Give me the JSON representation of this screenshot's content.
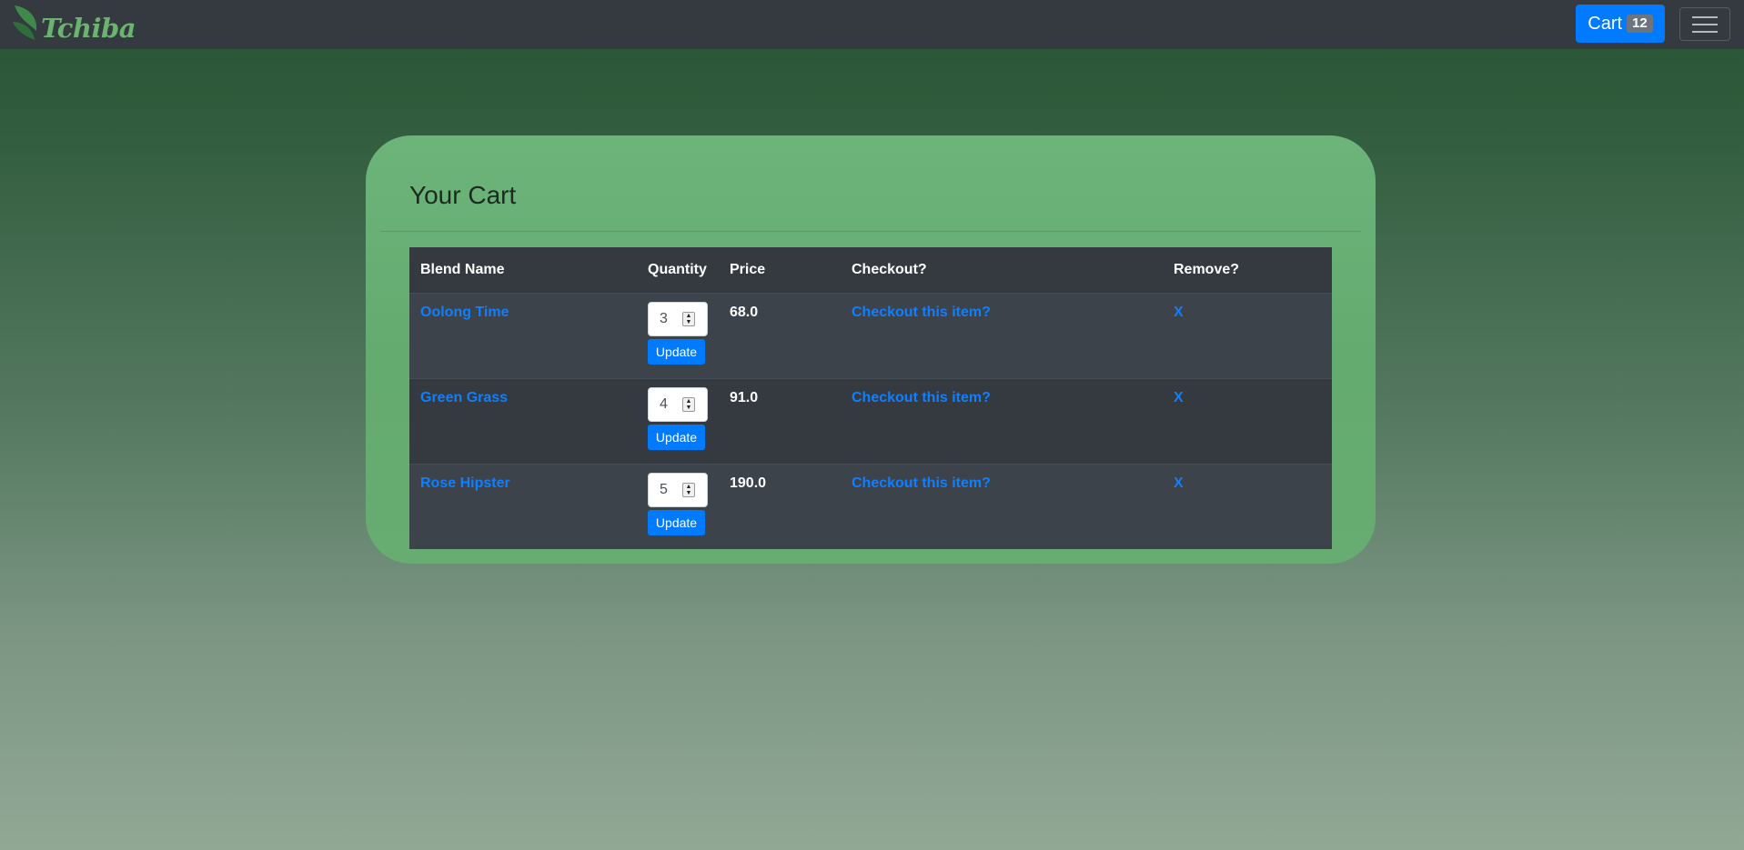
{
  "navbar": {
    "brand": "Tchiba",
    "cart_label": "Cart",
    "cart_count": "12",
    "menu_icon": "hamburger-menu-icon",
    "logo_icon": "tea-leaf-icon"
  },
  "cart": {
    "title": "Your Cart",
    "columns": [
      "Blend Name",
      "Quantity",
      "Price",
      "Checkout?",
      "Remove?"
    ],
    "items": [
      {
        "name": "Oolong Time",
        "quantity": "3",
        "price": "68.0",
        "checkout": "Checkout this item?",
        "remove": "X",
        "update": "Update"
      },
      {
        "name": "Green Grass",
        "quantity": "4",
        "price": "91.0",
        "checkout": "Checkout this item?",
        "remove": "X",
        "update": "Update"
      },
      {
        "name": "Rose Hipster",
        "quantity": "5",
        "price": "190.0",
        "checkout": "Checkout this item?",
        "remove": "X",
        "update": "Update"
      }
    ]
  },
  "colors": {
    "navbar": "#343a40",
    "accent": "#007bff",
    "panel": "#67b175",
    "link": "#0f7fff"
  }
}
